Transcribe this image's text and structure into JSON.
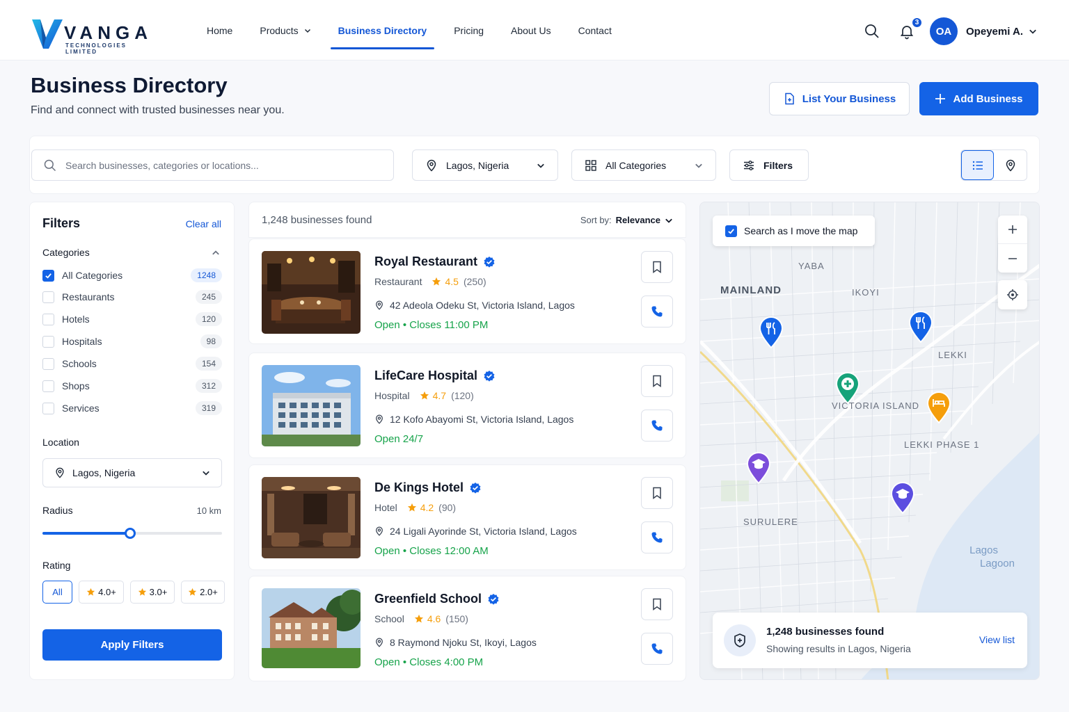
{
  "brand": {
    "name": "VANGA",
    "tagline": "TECHNOLOGIES LIMITED"
  },
  "nav": {
    "items": [
      {
        "label": "Home"
      },
      {
        "label": "Products"
      },
      {
        "label": "Business Directory"
      },
      {
        "label": "Pricing"
      },
      {
        "label": "About Us"
      },
      {
        "label": "Contact"
      }
    ],
    "notification_count": "3",
    "user": {
      "initials": "OA",
      "name": "Opeyemi A."
    }
  },
  "header": {
    "title": "Business Directory",
    "subtitle": "Find and connect with trusted businesses near you.",
    "list_business_label": "List Your Business",
    "add_business_label": "Add Business"
  },
  "search": {
    "placeholder": "Search businesses, categories or locations...",
    "location": "Lagos, Nigeria",
    "category": "All Categories",
    "filters_label": "Filters"
  },
  "filters": {
    "title": "Filters",
    "clear_label": "Clear all",
    "categories_heading": "Categories",
    "categories": [
      {
        "label": "All Categories",
        "count": "1248",
        "checked": true
      },
      {
        "label": "Restaurants",
        "count": "245",
        "checked": false
      },
      {
        "label": "Hotels",
        "count": "120",
        "checked": false
      },
      {
        "label": "Hospitals",
        "count": "98",
        "checked": false
      },
      {
        "label": "Schools",
        "count": "154",
        "checked": false
      },
      {
        "label": "Shops",
        "count": "312",
        "checked": false
      },
      {
        "label": "Services",
        "count": "319",
        "checked": false
      }
    ],
    "location_heading": "Location",
    "location_value": "Lagos, Nigeria",
    "radius_heading": "Radius",
    "radius_value": "10 km",
    "radius_fraction": 0.49,
    "rating_heading": "Rating",
    "rating_options": [
      "All",
      "4.0+",
      "3.0+",
      "2.0+"
    ],
    "apply_label": "Apply Filters"
  },
  "results": {
    "count_label": "1,248 businesses found",
    "sort_prefix": "Sort by:",
    "sort_value": "Relevance",
    "businesses": [
      {
        "name": "Royal Restaurant",
        "category": "Restaurant",
        "rating": "4.5",
        "reviews": "(250)",
        "address": "42 Adeola Odeku St, Victoria Island, Lagos",
        "status": "Open",
        "hours": "Closes 11:00 PM"
      },
      {
        "name": "LifeCare Hospital",
        "category": "Hospital",
        "rating": "4.7",
        "reviews": "(120)",
        "address": "12 Kofo Abayomi St, Victoria Island, Lagos",
        "status": "Open 24/7",
        "hours": ""
      },
      {
        "name": "De Kings Hotel",
        "category": "Hotel",
        "rating": "4.2",
        "reviews": "(90)",
        "address": "24 Ligali Ayorinde St, Victoria Island, Lagos",
        "status": "Open",
        "hours": "Closes 12:00 AM"
      },
      {
        "name": "Greenfield School",
        "category": "School",
        "rating": "4.6",
        "reviews": "(150)",
        "address": "8 Raymond Njoku St, Ikoyi, Lagos",
        "status": "Open",
        "hours": "Closes 4:00 PM"
      }
    ]
  },
  "map": {
    "search_as_move": "Search as I move the map",
    "labels": {
      "yaba": "YABA",
      "mainland": "MAINLAND",
      "ikoyi": "IKOYI",
      "lekki": "LEKKI",
      "victoria_island": "VICTORIA ISLAND",
      "lekki_phase": "LEKKI PHASE 1",
      "surulere": "SURULERE",
      "lagoon_1": "Lagos",
      "lagoon_2": "Lagoon"
    },
    "footer": {
      "title": "1,248 businesses found",
      "subtitle": "Showing results in Lagos, Nigeria",
      "link": "View list"
    },
    "pin_colors": {
      "restaurant": "#1463e6",
      "hospital": "#16a37a",
      "hotel": "#f59e0b",
      "school": "#7c4ddb",
      "school_alt": "#5b4ee0"
    }
  },
  "colors": {
    "accent": "#1463e6",
    "open": "#16a34a",
    "star": "#f59e0b"
  }
}
